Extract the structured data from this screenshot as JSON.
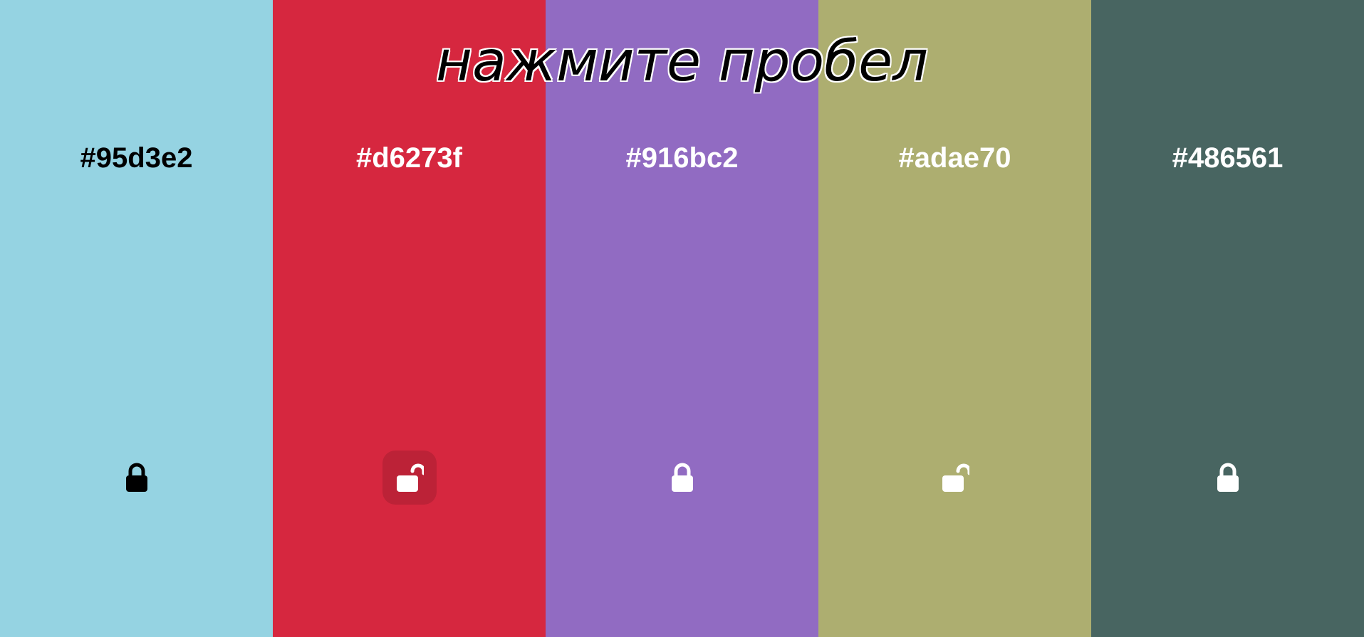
{
  "hint": "нажмите пробел",
  "columns": [
    {
      "hex": "#95d3e2",
      "background": "#95d3e2",
      "text_color": "#000000",
      "lock_icon": "lock-closed-icon",
      "locked": true
    },
    {
      "hex": "#d6273f",
      "background": "#d6273f",
      "text_color": "#ffffff",
      "lock_icon": "lock-open-icon",
      "locked": false
    },
    {
      "hex": "#916bc2",
      "background": "#916bc2",
      "text_color": "#ffffff",
      "lock_icon": "lock-closed-icon",
      "locked": true
    },
    {
      "hex": "#adae70",
      "background": "#adae70",
      "text_color": "#ffffff",
      "lock_icon": "lock-open-icon",
      "locked": false
    },
    {
      "hex": "#486561",
      "background": "#486561",
      "text_color": "#ffffff",
      "lock_icon": "lock-closed-icon",
      "locked": true
    }
  ]
}
